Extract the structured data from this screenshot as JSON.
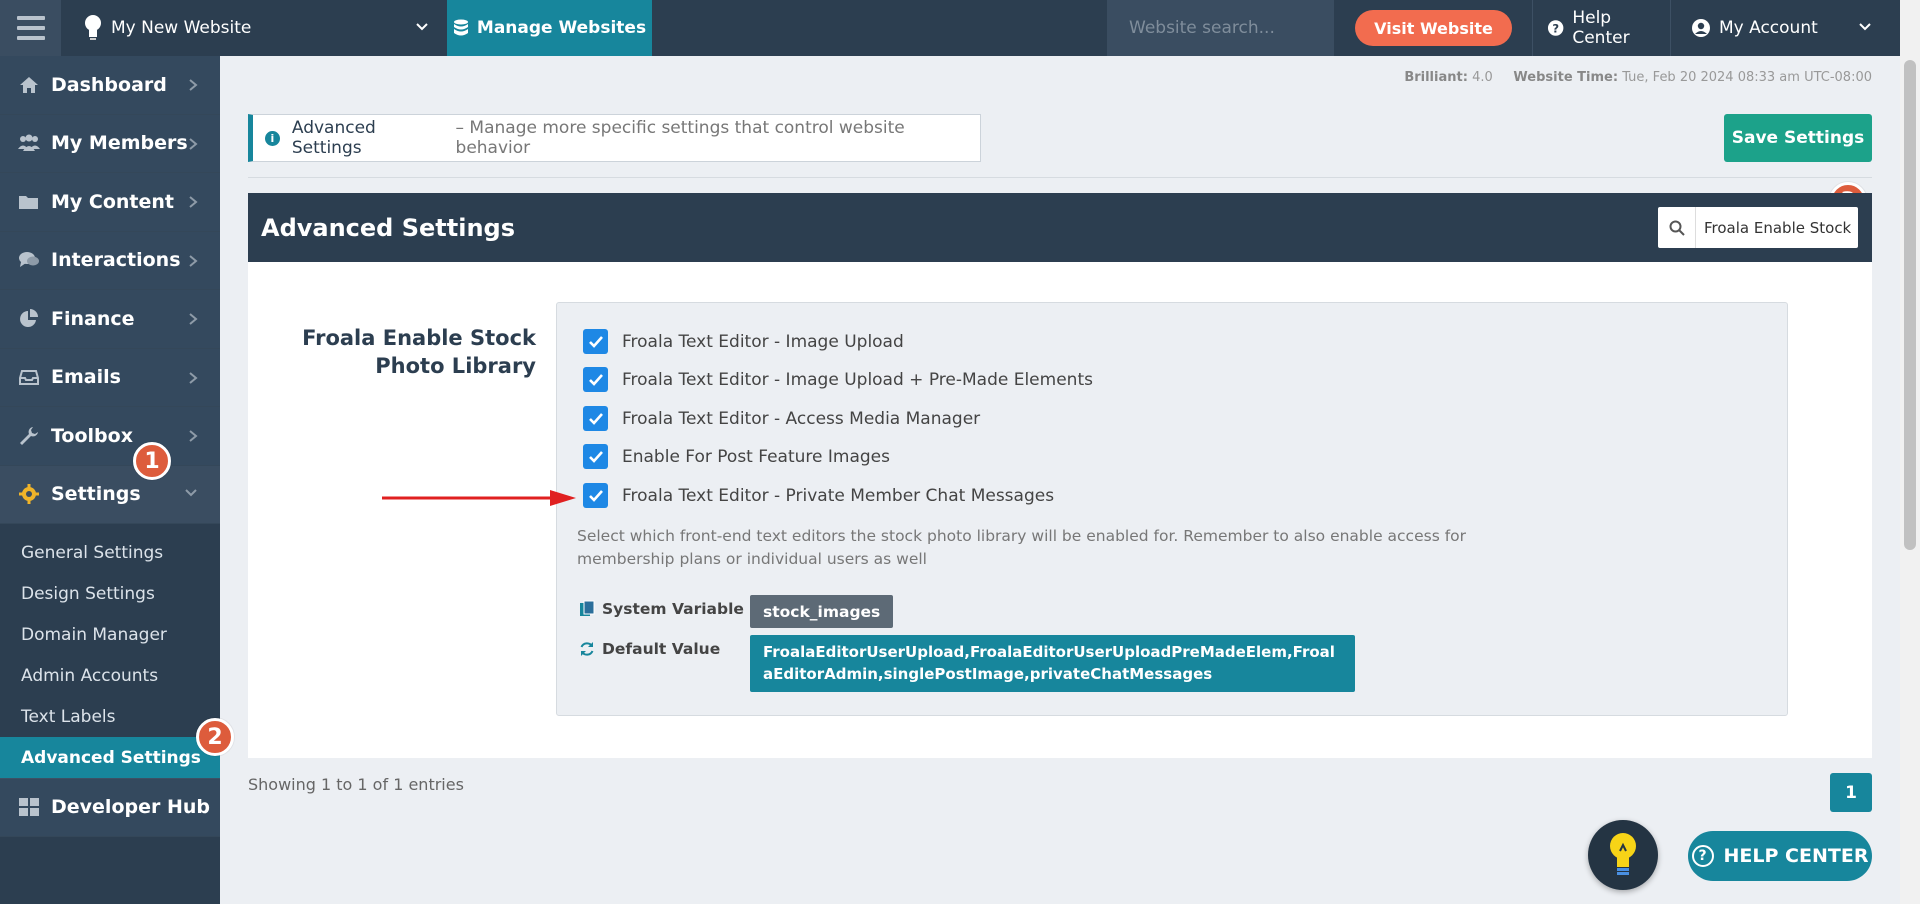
{
  "topbar": {
    "site_name": "My New Website",
    "manage_label": "Manage Websites",
    "search_placeholder": "Website search...",
    "visit_label": "Visit Website",
    "help_label": "Help Center",
    "account_label": "My Account"
  },
  "sidebar": {
    "items": [
      {
        "label": "Dashboard",
        "icon": "home-icon"
      },
      {
        "label": "My Members",
        "icon": "users-icon"
      },
      {
        "label": "My Content",
        "icon": "folder-icon"
      },
      {
        "label": "Interactions",
        "icon": "chat-icon"
      },
      {
        "label": "Finance",
        "icon": "pie-chart-icon"
      },
      {
        "label": "Emails",
        "icon": "inbox-icon"
      },
      {
        "label": "Toolbox",
        "icon": "wrench-icon"
      },
      {
        "label": "Settings",
        "icon": "gear-icon"
      }
    ],
    "sub_items": [
      "General Settings",
      "Design Settings",
      "Domain Manager",
      "Admin Accounts",
      "Text Labels",
      "Advanced Settings"
    ],
    "developer_hub": "Developer Hub"
  },
  "annotations": {
    "badge1": "1",
    "badge2": "2",
    "badge3": "3"
  },
  "meta": {
    "version_label": "Brilliant:",
    "version_value": "4.0",
    "time_label": "Website Time:",
    "time_value": "Tue, Feb 20 2024 08:33 am UTC-08:00"
  },
  "breadcrumb": {
    "title": "Advanced Settings",
    "description": "– Manage more specific settings that control website behavior"
  },
  "save_label": "Save Settings",
  "panel": {
    "title": "Advanced Settings",
    "search_value": "Froala Enable Stock"
  },
  "setting": {
    "label_line1": "Froala Enable Stock",
    "label_line2": "Photo Library",
    "options": [
      "Froala Text Editor - Image Upload",
      "Froala Text Editor - Image Upload + Pre-Made Elements",
      "Froala Text Editor - Access Media Manager",
      "Enable For Post Feature Images",
      "Froala Text Editor - Private Member Chat Messages"
    ],
    "help": "Select which front-end text editors the stock photo library will be enabled for. Remember to also enable access for membership plans or individual users as well",
    "system_variable_label": "System Variable",
    "system_variable_value": "stock_images",
    "default_value_label": "Default Value",
    "default_value": "FroalaEditorUserUpload,FroalaEditorUserUploadPreMadeElem,FroalaEditorAdmin,singlePostImage,privateChatMessages"
  },
  "footer": {
    "showing": "Showing 1 to 1 of 1 entries",
    "page": "1",
    "help_fab": "HELP CENTER"
  },
  "colors": {
    "navy": "#2c3e50",
    "teal": "#17869c",
    "green": "#1ca28a",
    "orange": "#f26c4f",
    "checkbox": "#1e88e5",
    "badge": "#dd5c3c"
  }
}
